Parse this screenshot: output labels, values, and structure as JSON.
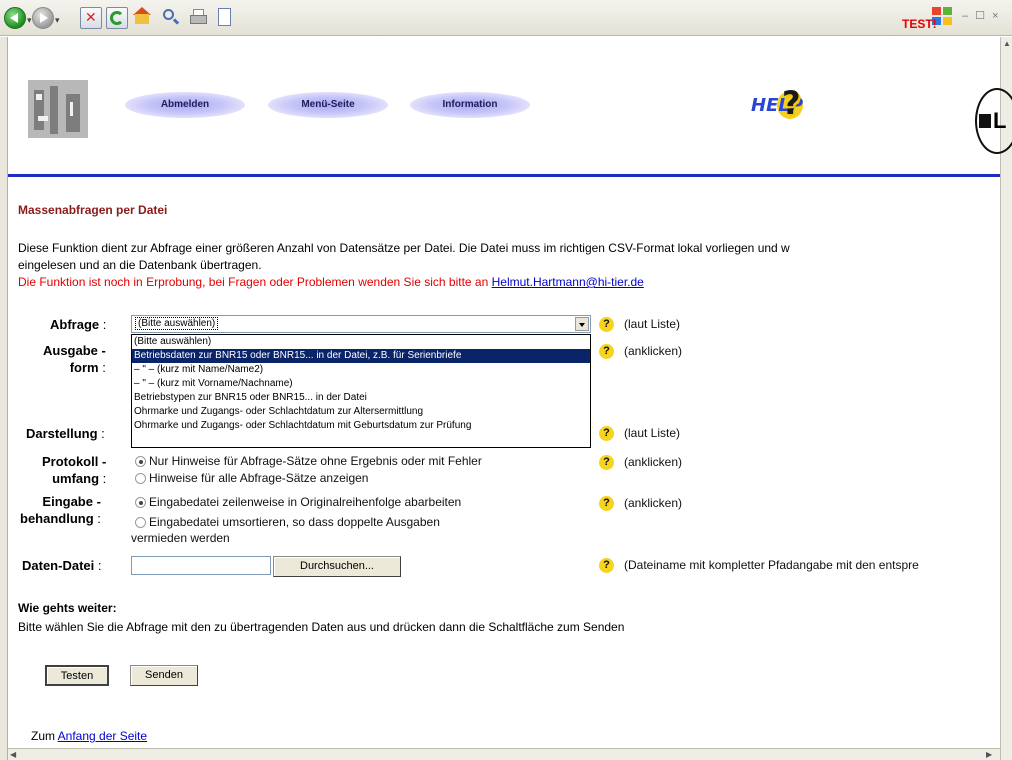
{
  "browser": {
    "window_controls": "– ☐ ×",
    "icons": [
      "back-icon",
      "forward-icon",
      "stop-icon",
      "refresh-icon",
      "home-icon",
      "search-icon",
      "print-icon",
      "edit-icon",
      "windows-logo-icon"
    ]
  },
  "header": {
    "test_label": "TEST!",
    "nav": [
      "Abmelden",
      "Menü-Seite",
      "Information"
    ],
    "help_text": "HELP",
    "help_mark": "?",
    "seal_letter": "L",
    "rule_color": "#1f2bc4"
  },
  "page": {
    "title": "Massenabfragen per Datei",
    "intro_line1": "Diese Funktion dient zur Abfrage einer größeren Anzahl von Datensätze per Datei. Die Datei muss im richtigen CSV-Format lokal vorliegen und w",
    "intro_line2": "eingelesen und an die Datenbank übertragen.",
    "intro_warning": "Die Funktion ist noch in Erprobung, bei Fragen oder Problemen wenden Sie sich bitte an ",
    "contact_email": "Helmut.Hartmann@hi-tier.de"
  },
  "form": {
    "abfrage": {
      "label": "Abfrage",
      "colon": ":",
      "selected": "(Bitte auswählen)",
      "hint": "(laut Liste)",
      "options": [
        "(Bitte auswählen)",
        "Betriebsdaten zur BNR15 oder BNR15... in der Datei, z.B. für Serienbriefe",
        "– \" – (kurz mit Name/Name2)",
        "– \" – (kurz mit Vorname/Nachname)",
        "Betriebstypen zur BNR15 oder BNR15... in der Datei",
        "Ohrmarke und Zugangs- oder Schlachtdatum zur Altersermittlung",
        "Ohrmarke und Zugangs- oder Schlachtdatum mit Geburtsdatum zur Prüfung"
      ],
      "highlighted_index": 1
    },
    "ausgabeform": {
      "label_line1": "Ausgabe -",
      "label_line2": "form",
      "colon": ":",
      "hint": "(anklicken)"
    },
    "darstellung": {
      "label": "Darstellung",
      "colon": ":",
      "hint": "(laut Liste)"
    },
    "protokoll": {
      "label_line1": "Protokoll -",
      "label_line2": "umfang",
      "colon": ":",
      "hint": "(anklicken)",
      "options": [
        "Nur Hinweise für Abfrage-Sätze ohne Ergebnis oder mit Fehler",
        "Hinweise für alle Abfrage-Sätze anzeigen"
      ],
      "selected_index": 0
    },
    "eingabe": {
      "label_line1": "Eingabe -",
      "label_line2": "behandlung",
      "colon": ":",
      "hint": "(anklicken)",
      "options": [
        "Eingabedatei zeilenweise in Originalreihenfolge abarbeiten",
        "Eingabedatei umsortieren, so dass doppelte Ausgaben"
      ],
      "option2_cont": "vermieden werden",
      "selected_index": 0
    },
    "datei": {
      "label": "Daten-Datei",
      "colon": ":",
      "value": "",
      "browse": "Durchsuchen...",
      "hint": "(Dateiname mit kompletter Pfadangabe mit den entspre"
    },
    "help_mark": "?"
  },
  "next": {
    "heading": "Wie gehts weiter:",
    "text": "Bitte wählen Sie die Abfrage mit den zu übertragenden Daten aus und drücken dann die Schaltfläche zum Senden"
  },
  "buttons": {
    "test": "Testen",
    "send": "Senden"
  },
  "footer": {
    "prefix": "Zum ",
    "link": "Anfang der Seite"
  }
}
